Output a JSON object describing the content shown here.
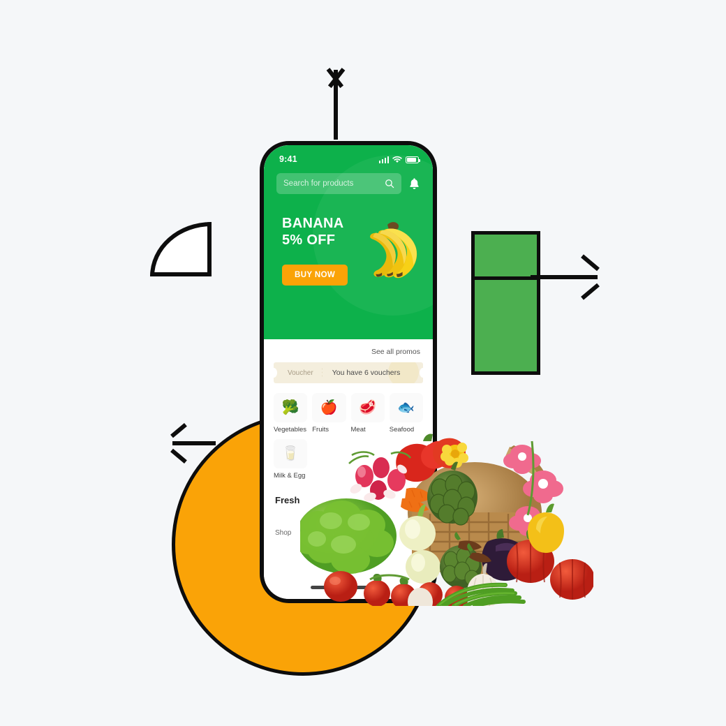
{
  "background_color": "#f5f7f9",
  "palette": {
    "brand_green": "#0DB14B",
    "rect_green": "#4CAF50",
    "accent_orange": "#FAA307",
    "outline_black": "#0d0d0d",
    "voucher_cream": "#f4eedd"
  },
  "shapes": {
    "quarter_circle": {
      "name": "quarter-circle-outline",
      "fill": "#ffffff",
      "stroke": "#0d0d0d"
    },
    "orange_circle": {
      "name": "orange-circle",
      "fill": "#FAA307",
      "stroke": "#0d0d0d"
    },
    "green_rectangle": {
      "name": "green-rectangle",
      "fill": "#4CAF50",
      "stroke": "#0d0d0d",
      "divided": true
    },
    "arrows": [
      {
        "name": "arrow-up",
        "direction": "up"
      },
      {
        "name": "arrow-right",
        "direction": "right"
      },
      {
        "name": "arrow-left",
        "direction": "left"
      }
    ]
  },
  "phone": {
    "status_bar": {
      "time": "9:41",
      "icons": [
        "signal-bars-icon",
        "wifi-icon",
        "battery-icon"
      ]
    },
    "search": {
      "placeholder": "Search for products",
      "value": "",
      "icon": "search-icon"
    },
    "notification": {
      "icon": "bell-icon",
      "label": "Notifications"
    },
    "hero": {
      "title_line1": "BANANA",
      "title_line2": "5% OFF",
      "cta_label": "BUY NOW",
      "image": "banana-bunch-image"
    },
    "promos": {
      "see_all_label": "See all promos"
    },
    "voucher": {
      "label": "Voucher",
      "text": "You have 6 vouchers",
      "count": 6
    },
    "categories": [
      {
        "label": "Vegetables",
        "icon": "broccoli-carrot-icon",
        "glyph": "🥦"
      },
      {
        "label": "Fruits",
        "icon": "apple-pineapple-icon",
        "glyph": "🍎"
      },
      {
        "label": "Meat",
        "icon": "meat-drumstick-icon",
        "glyph": "🥩"
      },
      {
        "label": "Seafood",
        "icon": "fish-icon",
        "glyph": "🐟"
      },
      {
        "label": "Milk & Egg",
        "icon": "milk-bottle-egg-icon",
        "glyph": "🥛"
      }
    ],
    "section": {
      "title": "Fresh",
      "subtitle": "Shop"
    },
    "home_indicator": "home-indicator"
  }
}
